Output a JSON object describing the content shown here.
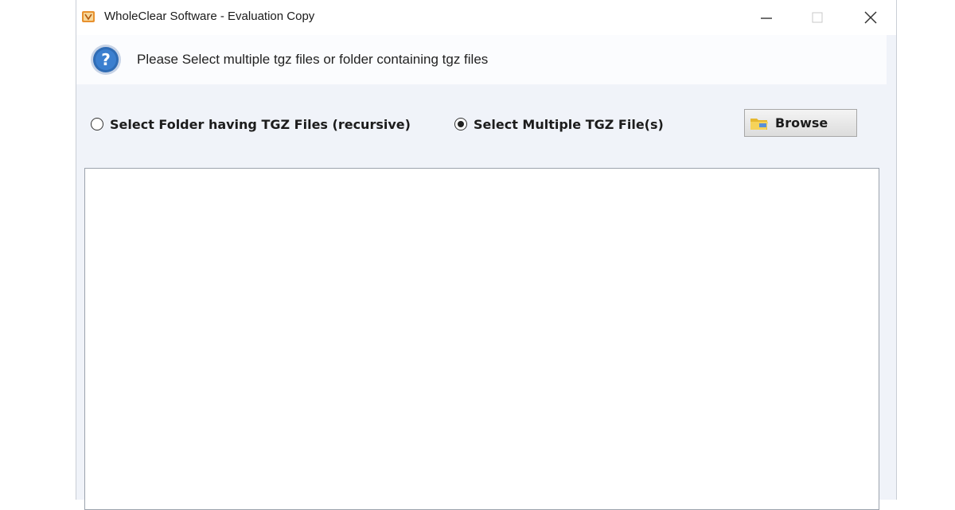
{
  "window": {
    "title": "WholeClear Software - Evaluation Copy",
    "app_icon": "wholeclear-app-icon",
    "controls": {
      "minimize": "minimize-icon",
      "maximize": "maximize-icon",
      "close": "close-icon"
    }
  },
  "info": {
    "icon": "question-icon",
    "message": "Please Select multiple tgz files or folder containing tgz files"
  },
  "options": {
    "folder_label": "Select Folder having TGZ Files (recursive)",
    "folder_selected": false,
    "files_label": "Select Multiple TGZ File(s)",
    "files_selected": true
  },
  "browse": {
    "label": "Browse",
    "icon": "folder-icon"
  },
  "file_list": {
    "items": []
  },
  "colors": {
    "window_bg": "#f0f3f9",
    "info_icon_blue": "#2f6cb5"
  }
}
